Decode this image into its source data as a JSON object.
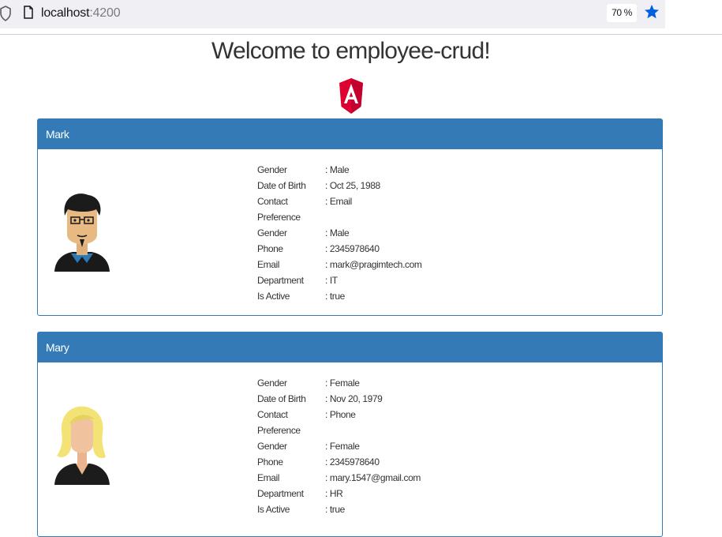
{
  "browser": {
    "url_host": "localhost",
    "url_port": ":4200",
    "zoom": "70 %",
    "icons": {
      "tracking": "shield-icon",
      "page": "page-icon",
      "bookmark": "star-icon"
    },
    "accent": "#0060df"
  },
  "header": {
    "title": "Welcome to employee-crud!",
    "logo": "angular-logo"
  },
  "colors": {
    "panel": "#337ab7",
    "panel_text": "#ffffff"
  },
  "employees": [
    {
      "name": "Mark",
      "avatar": "male-avatar",
      "fields": [
        {
          "label": "Gender",
          "value": ": Male"
        },
        {
          "label": "Date of Birth",
          "value": ": Oct 25, 1988"
        },
        {
          "label": "Contact",
          "value": ": Email"
        },
        {
          "label": "Preference",
          "value": ""
        },
        {
          "label": "Gender",
          "value": ": Male"
        },
        {
          "label": "Phone",
          "value": ": 2345978640"
        },
        {
          "label": "Email",
          "value": ": mark@pragimtech.com"
        },
        {
          "label": "Department",
          "value": ": IT"
        },
        {
          "label": "Is Active",
          "value": ": true"
        }
      ]
    },
    {
      "name": "Mary",
      "avatar": "female-avatar",
      "fields": [
        {
          "label": "Gender",
          "value": ": Female"
        },
        {
          "label": "Date of Birth",
          "value": ": Nov 20, 1979"
        },
        {
          "label": "Contact",
          "value": ": Phone"
        },
        {
          "label": "Preference",
          "value": ""
        },
        {
          "label": "Gender",
          "value": ": Female"
        },
        {
          "label": "Phone",
          "value": ": 2345978640"
        },
        {
          "label": "Email",
          "value": ": mary.1547@gmail.com"
        },
        {
          "label": "Department",
          "value": ": HR"
        },
        {
          "label": "Is Active",
          "value": ": true"
        }
      ]
    }
  ]
}
